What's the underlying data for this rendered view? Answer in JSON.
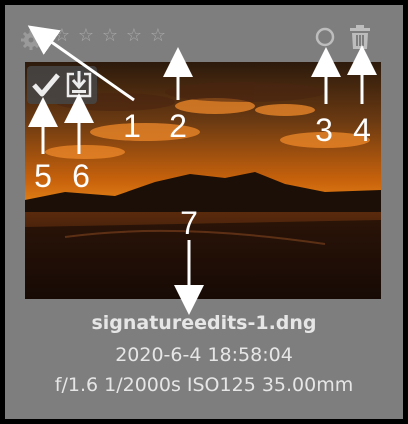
{
  "card": {
    "stars": [
      "☆",
      "☆",
      "☆",
      "☆",
      "☆"
    ],
    "filename": "signatureedits-1.dng",
    "datetime": "2020-6-4 18:58:04",
    "exif": "f/1.6 1/2000s ISO125 35.00mm"
  },
  "icons": {
    "gear": "gear-icon",
    "reject": "reject-circle-icon",
    "trash": "trash-icon",
    "check": "check-icon",
    "download": "download-icon"
  },
  "callouts": [
    "1",
    "2",
    "3",
    "4",
    "5",
    "6",
    "7"
  ],
  "colors": {
    "card_bg": "#7e7e7e",
    "text": "#e6e6e6",
    "annotation": "#ffffff"
  }
}
